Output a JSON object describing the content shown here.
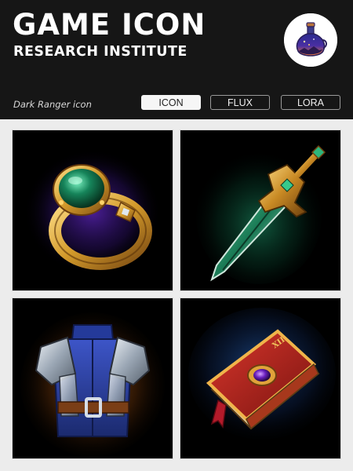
{
  "header": {
    "title": "GAME ICON",
    "subtitle": "RESEARCH INSTITUTE",
    "caption": "Dark Ranger icon",
    "logo_icon": "potion-bottle-logo-icon"
  },
  "tabs": [
    {
      "label": "ICON",
      "active": true
    },
    {
      "label": "FLUX",
      "active": false
    },
    {
      "label": "LORA",
      "active": false
    }
  ],
  "gallery": [
    {
      "icon": "emerald-ring-icon",
      "glow": "#7a3cff"
    },
    {
      "icon": "dagger-icon",
      "glow": "#2fd69a"
    },
    {
      "icon": "armor-vest-icon",
      "glow": "#ff9a2e"
    },
    {
      "icon": "spellbook-icon",
      "glow": "#3a7bd6",
      "book_numeral": "XII"
    }
  ],
  "colors": {
    "header_bg": "#161616",
    "page_bg": "#ececec",
    "active_tab_bg": "#f6f6f6"
  }
}
